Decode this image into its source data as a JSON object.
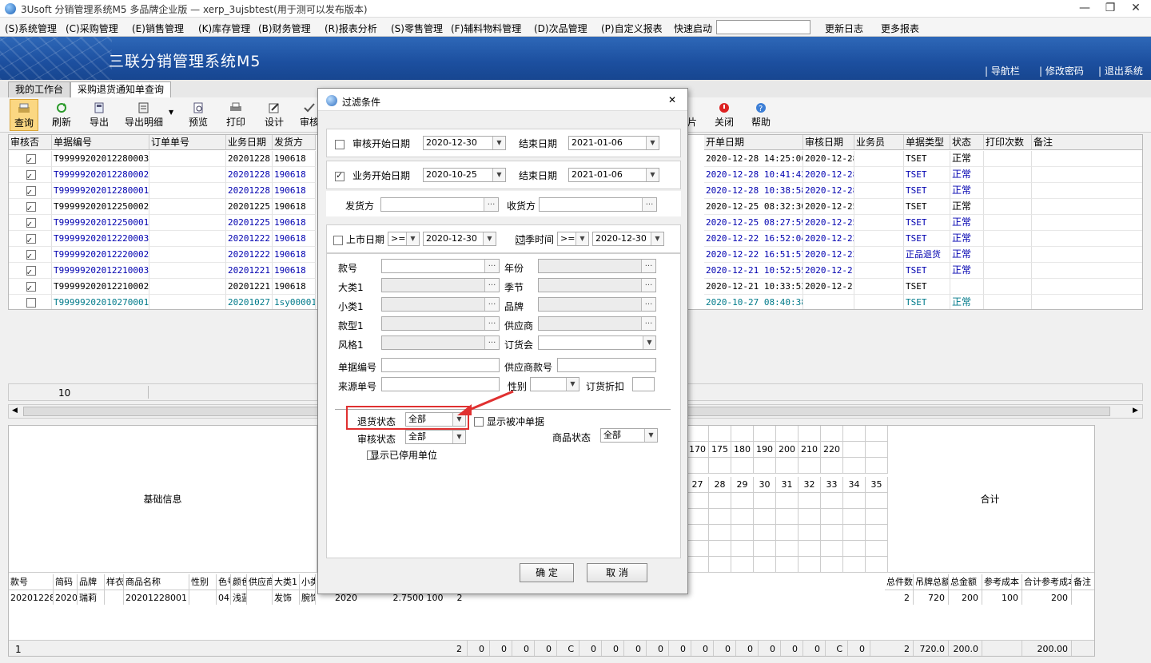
{
  "window": {
    "title": "3Usoft 分销管理系统M5 多品牌企业版 — xerp_3ujsbtest(用于测可以发布版本)",
    "minimize": "—",
    "maximize": "❐",
    "close": "✕"
  },
  "menu": {
    "items": [
      "(S)系统管理",
      "(C)采购管理",
      "(E)销售管理",
      "(K)库存管理",
      "(B)财务管理",
      "(R)报表分析",
      "(S)零售管理",
      "(F)辅料物料管理",
      "(D)次品管理",
      "(P)自定义报表"
    ],
    "quick_start_label": "快速启动",
    "quick_start_value": "",
    "changelog": "更新日志",
    "more_reports": "更多报表"
  },
  "banner": {
    "title": "三联分销管理系统M5",
    "links": [
      "| 导航栏",
      "| 修改密码",
      "| 退出系统"
    ]
  },
  "tabs": [
    "我的工作台",
    "采购退货通知单查询"
  ],
  "toolbar": {
    "query": "查询",
    "refresh": "刷新",
    "export": "导出",
    "export_detail": "导出明细",
    "preview": "预览",
    "print": "打印",
    "design": "设计",
    "audit": "审核",
    "partial": "片",
    "close": "关闭",
    "help": "帮助"
  },
  "grid": {
    "headers_left": [
      "审核否",
      "单据编号",
      "订单单号",
      "业务日期",
      "发货方"
    ],
    "headers_right": [
      "开单日期",
      "审核日期",
      "业务员",
      "单据类型",
      "状态",
      "打印次数",
      "备注"
    ],
    "rows": [
      {
        "checked": true,
        "no": "T99999202012280003",
        "date": "20201228",
        "sender": "190618",
        "open": "2020-12-28 14:25:00",
        "audit": "2020-12-28",
        "type": "TSET",
        "status": "正常",
        "blue": false
      },
      {
        "checked": true,
        "no": "T99999202012280002",
        "date": "20201228",
        "sender": "190618",
        "open": "2020-12-28 10:41:42",
        "audit": "2020-12-28",
        "type": "TSET",
        "status": "正常",
        "blue": true
      },
      {
        "checked": true,
        "no": "T99999202012280001",
        "date": "20201228",
        "sender": "190618",
        "open": "2020-12-28 10:38:58",
        "audit": "2020-12-28",
        "type": "TSET",
        "status": "正常",
        "blue": true
      },
      {
        "checked": true,
        "no": "T99999202012250002",
        "date": "20201225",
        "sender": "190618",
        "open": "2020-12-25 08:32:30",
        "audit": "2020-12-25",
        "type": "TSET",
        "status": "正常",
        "blue": false
      },
      {
        "checked": true,
        "no": "T99999202012250001",
        "date": "20201225",
        "sender": "190618",
        "open": "2020-12-25 08:27:59",
        "audit": "2020-12-25",
        "type": "TSET",
        "status": "正常",
        "blue": true
      },
      {
        "checked": true,
        "no": "T99999202012220003",
        "date": "20201222",
        "sender": "190618",
        "open": "2020-12-22 16:52:04",
        "audit": "2020-12-22",
        "type": "TSET",
        "status": "正常",
        "blue": true
      },
      {
        "checked": true,
        "no": "T99999202012220002",
        "date": "20201222",
        "sender": "190618",
        "open": "2020-12-22 16:51:57",
        "audit": "2020-12-22",
        "type": "正品退货",
        "status": "正常",
        "blue": true
      },
      {
        "checked": true,
        "no": "T99999202012210003",
        "date": "20201221",
        "sender": "190618",
        "open": "2020-12-21 10:52:55",
        "audit": "2020-12-21",
        "type": "TSET",
        "status": "正常",
        "blue": true
      },
      {
        "checked": true,
        "no": "T99999202012210002",
        "date": "20201221",
        "sender": "190618",
        "open": "2020-12-21 10:33:53",
        "audit": "2020-12-21",
        "type": "TSET",
        "status": "",
        "blue": false
      },
      {
        "checked": false,
        "no": "T99999202010270001",
        "date": "20201027",
        "sender": "1sy00001",
        "open": "2020-10-27 08:40:38",
        "audit": "",
        "type": "TSET",
        "status": "正常",
        "blue": true,
        "teal": true
      }
    ],
    "footer_count": "10"
  },
  "lower": {
    "basic_info": "基础信息",
    "total": "合计",
    "sizes_top": [
      "170",
      "175",
      "180",
      "190",
      "200",
      "210",
      "220"
    ],
    "sizes_bottom": [
      "27",
      "28",
      "29",
      "30",
      "31",
      "32",
      "33",
      "34",
      "35"
    ],
    "headers_left": [
      "款号",
      "简码",
      "品牌",
      "样衣",
      "商品名称",
      "性别",
      "色号",
      "颜色",
      "供应商",
      "大类1",
      "小类"
    ],
    "headers_right": [
      "总件数",
      "吊牌总额",
      "总金额",
      "参考成本",
      "合计参考成本",
      "备注"
    ],
    "row_left": [
      "20201228001",
      "2020",
      "瑞莉",
      "",
      "20201228001",
      "",
      "04",
      "浅蓝",
      "",
      "发饰",
      "腕饰"
    ],
    "row_mid": [
      "2020",
      "2.7500 100",
      "2"
    ],
    "row_right": [
      "2",
      "720",
      "200",
      "100",
      "200",
      ""
    ],
    "footer": {
      "count": "1",
      "nums": [
        "2",
        "0",
        "0",
        "0",
        "0",
        "C",
        "0",
        "0",
        "0",
        "0",
        "0",
        "0",
        "0",
        "0",
        "0",
        "0",
        "0",
        "C",
        "0"
      ],
      "totals": [
        "2",
        "720.0",
        "200.0",
        "",
        "200.00"
      ]
    }
  },
  "dialog": {
    "title": "过滤条件",
    "close": "✕",
    "audit_start_label": "审核开始日期",
    "audit_start": "2020-12-30",
    "end_label": "结束日期",
    "audit_end": "2021-01-06",
    "audit_checked": false,
    "biz_start_label": "业务开始日期",
    "biz_start": "2020-10-25",
    "biz_end": "2021-01-06",
    "biz_checked": true,
    "sender_label": "发货方",
    "receiver_label": "收货方",
    "market_label": "上市日期",
    "market_op": ">=",
    "market_date": "2020-12-30",
    "season_label": "过季时间",
    "season_op": ">=",
    "season_date": "2020-12-30",
    "fields_left": [
      "款号",
      "大类1",
      "小类1",
      "款型1",
      "风格1"
    ],
    "fields_right": [
      "年份",
      "季节",
      "品牌",
      "供应商",
      "订货会"
    ],
    "doc_no_label": "单据编号",
    "supplier_code_label": "供应商款号",
    "source_no_label": "来源单号",
    "gender_label": "性别",
    "discount_label": "订货折扣",
    "return_status_label": "退货状态",
    "return_status": "全部",
    "show_offset_label": "显示被冲单据",
    "audit_status_label": "审核状态",
    "audit_status": "全部",
    "product_status_label": "商品状态",
    "product_status": "全部",
    "show_disabled_label": "显示已停用单位",
    "ok": "确 定",
    "cancel": "取 消",
    "highlight_color": "#e03030"
  }
}
